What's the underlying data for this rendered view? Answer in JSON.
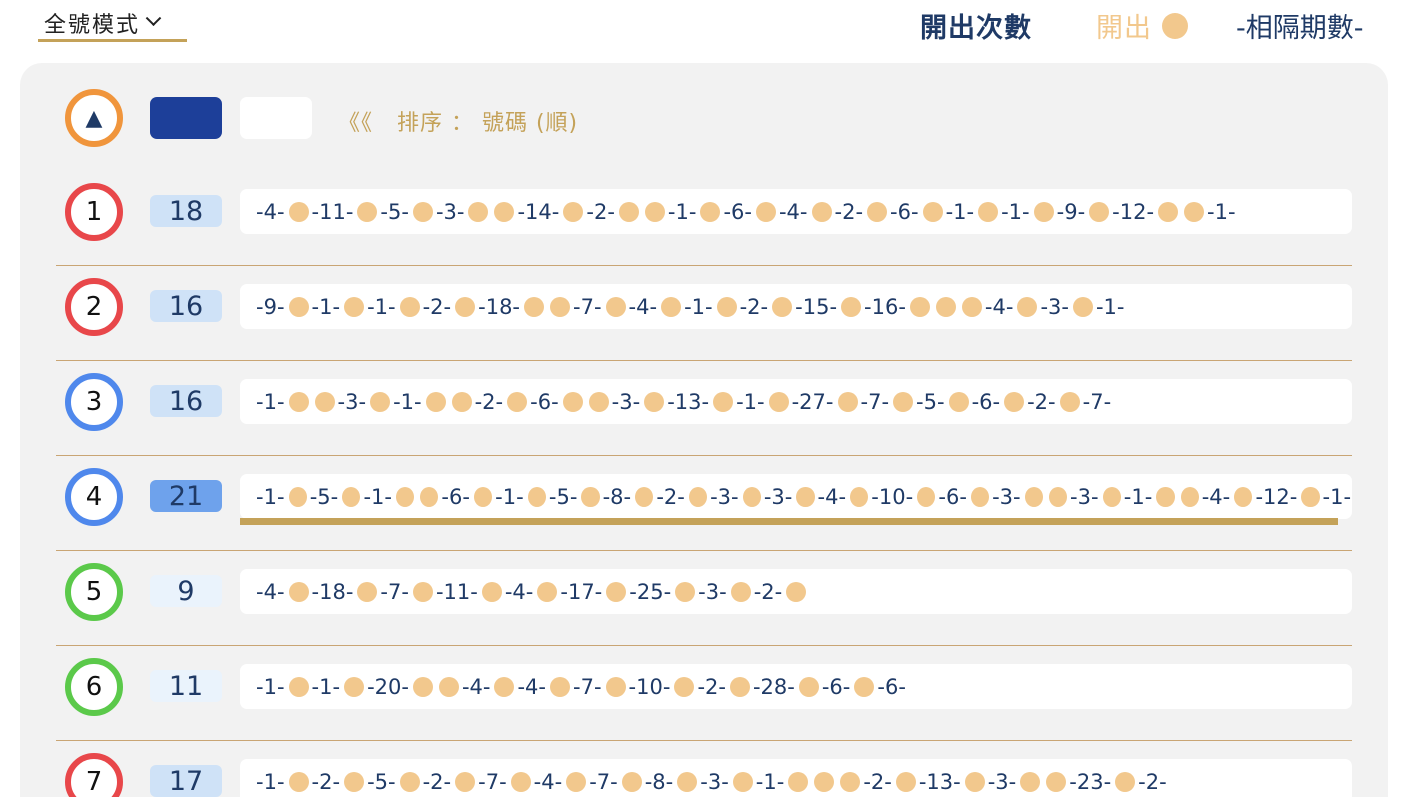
{
  "toolbar": {
    "mode_label": "全號模式",
    "legend_count": "開出次數",
    "legend_open": "開出",
    "legend_gap": "-相隔期數-"
  },
  "sort": {
    "ball_symbol": "▲",
    "text": "《《   排序 ： 號碼 (順)"
  },
  "colors": {
    "red": "#e8474a",
    "blue": "#4f88ec",
    "green": "#5bc94a",
    "orange": "#f0953c",
    "gold": "#c4a259",
    "peach": "#f2c88d",
    "navy": "#1f3a66"
  },
  "rows": [
    {
      "number": "1",
      "count": "18",
      "ring": "red",
      "sequence": [
        "-4-",
        "●",
        "-11-",
        "●",
        "-5-",
        "●",
        "-3-",
        "●",
        "●",
        "-14-",
        "●",
        "-2-",
        "●",
        "●",
        "-1-",
        "●",
        "-6-",
        "●",
        "-4-",
        "●",
        "-2-",
        "●",
        "-6-",
        "●",
        "-1-",
        "●",
        "-1-",
        "●",
        "-9-",
        "●",
        "-12-",
        "●",
        "●",
        "-1-"
      ]
    },
    {
      "number": "2",
      "count": "16",
      "ring": "red",
      "sequence": [
        "-9-",
        "●",
        "-1-",
        "●",
        "-1-",
        "●",
        "-2-",
        "●",
        "-18-",
        "●",
        "●",
        "-7-",
        "●",
        "-4-",
        "●",
        "-1-",
        "●",
        "-2-",
        "●",
        "-15-",
        "●",
        "-16-",
        "●",
        "●",
        "●",
        "-4-",
        "●",
        "-3-",
        "●",
        "-1-"
      ]
    },
    {
      "number": "3",
      "count": "16",
      "ring": "blue",
      "sequence": [
        "-1-",
        "●",
        "●",
        "-3-",
        "●",
        "-1-",
        "●",
        "●",
        "-2-",
        "●",
        "-6-",
        "●",
        "●",
        "-3-",
        "●",
        "-13-",
        "●",
        "-1-",
        "●",
        "-27-",
        "●",
        "-7-",
        "●",
        "-5-",
        "●",
        "-6-",
        "●",
        "-2-",
        "●",
        "-7-"
      ]
    },
    {
      "number": "4",
      "count": "21",
      "ring": "blue",
      "highlight": true,
      "sequence": [
        "-1-",
        "●",
        "-5-",
        "●",
        "-1-",
        "●",
        "●",
        "-6-",
        "●",
        "-1-",
        "●",
        "-5-",
        "●",
        "-8-",
        "●",
        "-2-",
        "●",
        "-3-",
        "●",
        "-3-",
        "●",
        "-4-",
        "●",
        "-10-",
        "●",
        "-6-",
        "●",
        "-3-",
        "●",
        "●",
        "-3-",
        "●",
        "-1-",
        "●",
        "●",
        "-4-",
        "●",
        "-12-",
        "●",
        "-1-"
      ]
    },
    {
      "number": "5",
      "count": "9",
      "ring": "green",
      "sequence": [
        "-4-",
        "●",
        "-18-",
        "●",
        "-7-",
        "●",
        "-11-",
        "●",
        "-4-",
        "●",
        "-17-",
        "●",
        "-25-",
        "●",
        "-3-",
        "●",
        "-2-",
        "●"
      ]
    },
    {
      "number": "6",
      "count": "11",
      "ring": "green",
      "sequence": [
        "-1-",
        "●",
        "-1-",
        "●",
        "-20-",
        "●",
        "●",
        "-4-",
        "●",
        "-4-",
        "●",
        "-7-",
        "●",
        "-10-",
        "●",
        "-2-",
        "●",
        "-28-",
        "●",
        "-6-",
        "●",
        "-6-"
      ]
    },
    {
      "number": "7",
      "count": "17",
      "ring": "red",
      "sequence": [
        "-1-",
        "●",
        "-2-",
        "●",
        "-5-",
        "●",
        "-2-",
        "●",
        "-7-",
        "●",
        "-4-",
        "●",
        "-7-",
        "●",
        "-8-",
        "●",
        "-3-",
        "●",
        "-1-",
        "●",
        "●",
        "●",
        "-2-",
        "●",
        "-13-",
        "●",
        "-3-",
        "●",
        "●",
        "-23-",
        "●",
        "-2-"
      ]
    }
  ]
}
